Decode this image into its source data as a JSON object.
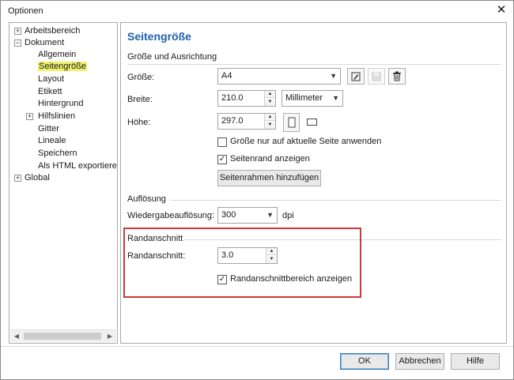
{
  "window": {
    "title": "Optionen"
  },
  "tree": {
    "items": [
      {
        "label": "Arbeitsbereich"
      },
      {
        "label": "Dokument"
      },
      {
        "label": "Allgemein"
      },
      {
        "label": "Seitengröße"
      },
      {
        "label": "Layout"
      },
      {
        "label": "Etikett"
      },
      {
        "label": "Hintergrund"
      },
      {
        "label": "Hilfslinien"
      },
      {
        "label": "Gitter"
      },
      {
        "label": "Lineale"
      },
      {
        "label": "Speichern"
      },
      {
        "label": "Als HTML exportieren"
      },
      {
        "label": "Global"
      }
    ],
    "selected": "Seitengröße"
  },
  "panel": {
    "heading": "Seitengröße",
    "size_section": {
      "title": "Größe und Ausrichtung",
      "size_label": "Größe:",
      "size_value": "A4",
      "width_label": "Breite:",
      "width_value": "210.0",
      "unit_value": "Millimeter",
      "height_label": "Höhe:",
      "height_value": "297.0",
      "apply_current_label": "Größe nur auf aktuelle Seite anwenden",
      "apply_current_checked": false,
      "show_border_label": "Seitenrand anzeigen",
      "show_border_checked": true,
      "add_frame_button": "Seitenrahmen hinzufügen"
    },
    "resolution_section": {
      "title": "Auflösung",
      "label": "Wiedergabeauflösung:",
      "value": "300",
      "unit": "dpi"
    },
    "bleed_section": {
      "title": "Randanschnitt",
      "label": "Randanschnitt:",
      "value": "3.0",
      "show_area_label": "Randanschnittbereich anzeigen",
      "show_area_checked": true
    }
  },
  "buttons": {
    "ok": "OK",
    "cancel": "Abbrechen",
    "help": "Hilfe"
  },
  "colors": {
    "heading": "#1e62a8",
    "selected_bg": "#eef26b",
    "highlight_border": "#cc3b3b"
  },
  "icons": [
    "close-icon",
    "expander-icon",
    "save-preset-icon",
    "disk-icon",
    "trash-icon",
    "portrait-icon",
    "landscape-icon",
    "chevron-down-icon",
    "spin-up-icon",
    "spin-down-icon"
  ]
}
